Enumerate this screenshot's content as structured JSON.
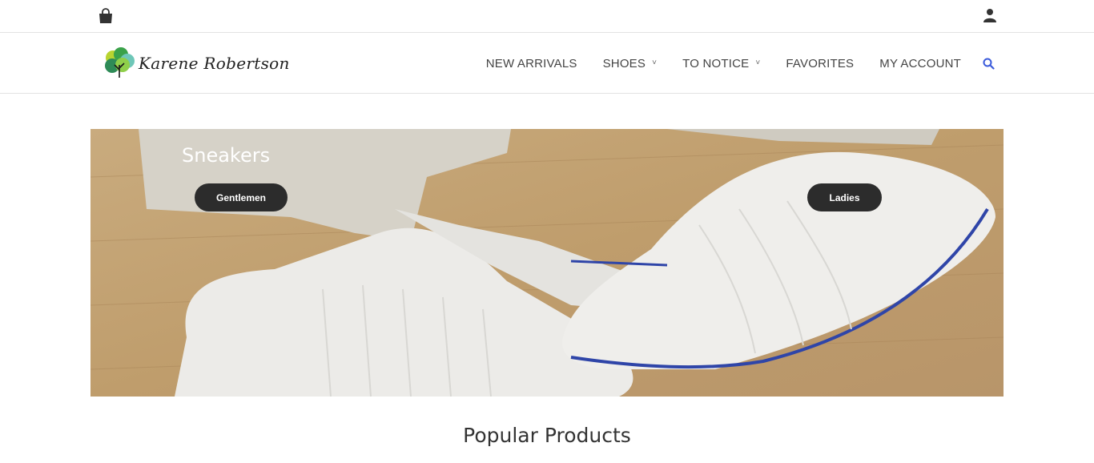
{
  "topbar": {
    "cart_icon": "shopping-bag-icon",
    "user_icon": "user-icon"
  },
  "header": {
    "logo_text": "Karene Robertson",
    "logo_icon": "tree-logo-icon",
    "nav": [
      {
        "label": "NEW ARRIVALS",
        "has_dropdown": false
      },
      {
        "label": "SHOES",
        "has_dropdown": true
      },
      {
        "label": "TO NOTICE",
        "has_dropdown": true
      },
      {
        "label": "FAVORITES",
        "has_dropdown": false
      },
      {
        "label": "MY ACCOUNT",
        "has_dropdown": false
      }
    ],
    "search_icon": "search-icon",
    "dropdown_glyph": "˅"
  },
  "hero": {
    "title": "Sneakers",
    "btn_gentlemen": "Gentlemen",
    "btn_ladies": "Ladies"
  },
  "section": {
    "title": "Popular Products"
  },
  "colors": {
    "accent": "#3b5bdb",
    "button_bg": "#2c2c2c"
  }
}
